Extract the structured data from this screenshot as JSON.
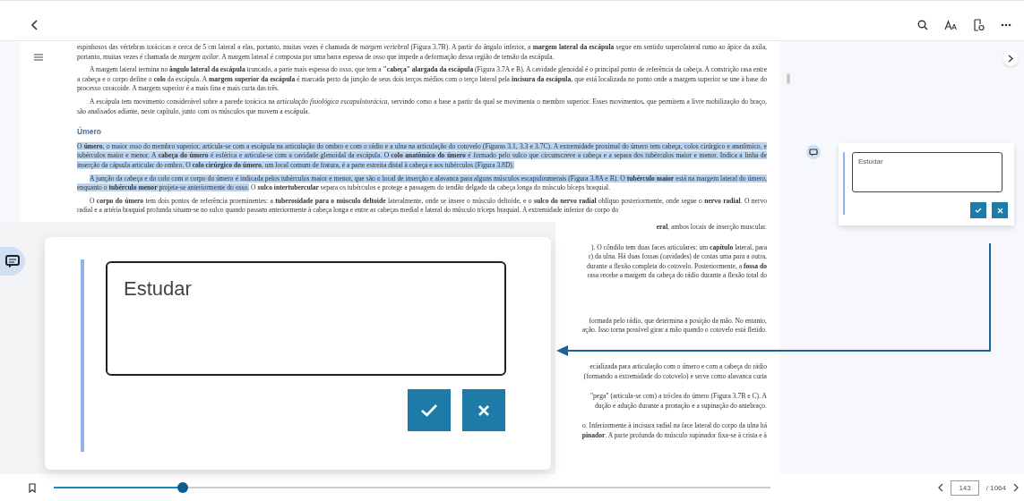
{
  "document": {
    "blocks": [
      {
        "kind": "paragraph",
        "indent": false,
        "segments": [
          {
            "text": "espinhosos das vértebras torácicas e cerca de 5 cm lateral a elas, portanto, muitas vezes é chamada de *margem vertebral* (Figura 3.7B). A partir do ângulo inferior, a **margem lateral da escápula** segue em sentido superolateral rumo ao ápice da axila, portanto, muitas vezes é chamada de *margem axilar*. A margem lateral é composta por uma barra espessa de osso que impede a deformação dessa região de tensão da escápula.",
            "highlighted": false
          }
        ]
      },
      {
        "kind": "paragraph",
        "indent": true,
        "segments": [
          {
            "text": "A margem lateral termina no **ângulo lateral da escápula** truncado, a parte mais espessa do osso, que tem a **\"cabeça\" alargada da escápula** (Figura 3.7A e B). A cavidade glenoidal é o principal ponto de referência da cabeça. A constrição rasa entre a cabeça e o corpo define o **colo** da escápula. A **margem superior da escápula** é marcada perto da junção de seus dois terços médios com o terço lateral pela **incisura da escápula**, que está localizada no ponto onde a margem superior se une à base do processo coracoide. A margem superior é a mais fina e mais curta das três.",
            "highlighted": false
          }
        ]
      },
      {
        "kind": "paragraph",
        "indent": true,
        "segments": [
          {
            "text": "A escápula tem movimento considerável sobre a parede torácica na *articulação fisiológica escapulotorácica*, servindo como a base a partir da qual se movimenta o membro superior. Esses movimentos, que permitem a livre mobilização do braço, são analisados adiante, neste capítulo, junto com os músculos que movem a escápula.",
            "highlighted": false
          }
        ]
      },
      {
        "kind": "heading",
        "text": "Úmero"
      },
      {
        "kind": "paragraph",
        "indent": false,
        "segments": [
          {
            "text": "O **úmero**, o maior osso do membro superior, articula-se com a escápula na articulação do ombro e com o rádio e a ulna na articulação do cotovelo (Figuras 3.1, 3.3 e 3.7C). A extremidade proximal do úmero tem cabeça, colos cirúrgico e anatômico, e tubérculos maior e menor. A **cabeça do úmero** é esférica e articula-se com a cavidade glenoidal da escápula. O **colo anatômico do úmero** é formado pelo sulco que circunscreve a cabeça e a separa dos tubérculos maior e menor. Indica a linha de inserção da cápsula articular do ombro. O **colo cirúrgico do úmero**, um local comum de fratura, é a parte estreita distal à cabeça e aos tubérculos (Figura 3.8D).",
            "highlighted": true
          }
        ]
      },
      {
        "kind": "paragraph",
        "indent": true,
        "segments": [
          {
            "text": "A junção da cabeça e do colo com o corpo do úmero é indicada pelos tubérculos maior e menor, que são o local de inserção e alavanca para alguns músculos escapuloumerais (Figura 3.8A e B). O **tubérculo maior** está na margem lateral do úmero, enquanto o **tubérculo menor** projeta-se anteriormente do osso.",
            "highlighted": true
          },
          {
            "text": " O **sulco intertubercular** separa os tubérculos e protege a passagem do tendão delgado da cabeça longa do músculo bíceps braquial.",
            "highlighted": false
          }
        ]
      },
      {
        "kind": "paragraph",
        "indent": true,
        "segments": [
          {
            "text": "O **corpo do úmero** tem dois pontos de referência proeminentes: a **tuberosidade para o músculo deltoide** lateralmente, onde se insere o músculo deltoide, e o **sulco do nervo radial** oblíquo posteriormente, onde segue o **nervo radial**. O nervo radial e a artéria braquial profunda situam-se no sulco quando passam anteriormente à cabeça longa e entre as cabeças medial e lateral do músculo tríceps braquial. A extremidade inferior do corpo do",
            "highlighted": false
          }
        ]
      }
    ],
    "visible_line_ends": [
      [
        "**eral**, ambos locais de inserção muscular."
      ],
      [
        "). O côndilo tem duas faces articulares: um **capítulo** lateral, para",
        "r) da ulna. Há duas fossas (cavidades) de costas uma para a outra,",
        "durante a flexão completa do cotovelo. Posteriormente, a **fossa do**",
        "rasa recebe a margem da cabeça do rádio durante a flexão total do"
      ],
      [
        "formada pelo rádio, que determina a posição da mão. No entanto,",
        "ação. Isso torna possível girar a mão quando o cotovelo está fletido."
      ],
      [
        "ecializada para articulação com o úmero e com a cabeça do rádio",
        "(formando a extremidade do cotovelo) e serve como alavanca curta"
      ],
      [
        "\"pega\" (articula-se com) a tróclea do úmero (Figura 3.7B e C). A",
        "dução e adução durante a pronação e a supinação do antebraço."
      ],
      [
        "o. Inferiormente à incisura radial na face lateral do corpo da ulna há",
        "**pinador**. A parte profunda do músculo supinador fixa-se à crista e à"
      ]
    ]
  },
  "note": {
    "text": "Estudar"
  },
  "zoomed_note": {
    "text": "Estudar"
  },
  "reading_progress": {
    "level": 0.18
  },
  "pager": {
    "page": "143",
    "total": "/ 1064"
  }
}
